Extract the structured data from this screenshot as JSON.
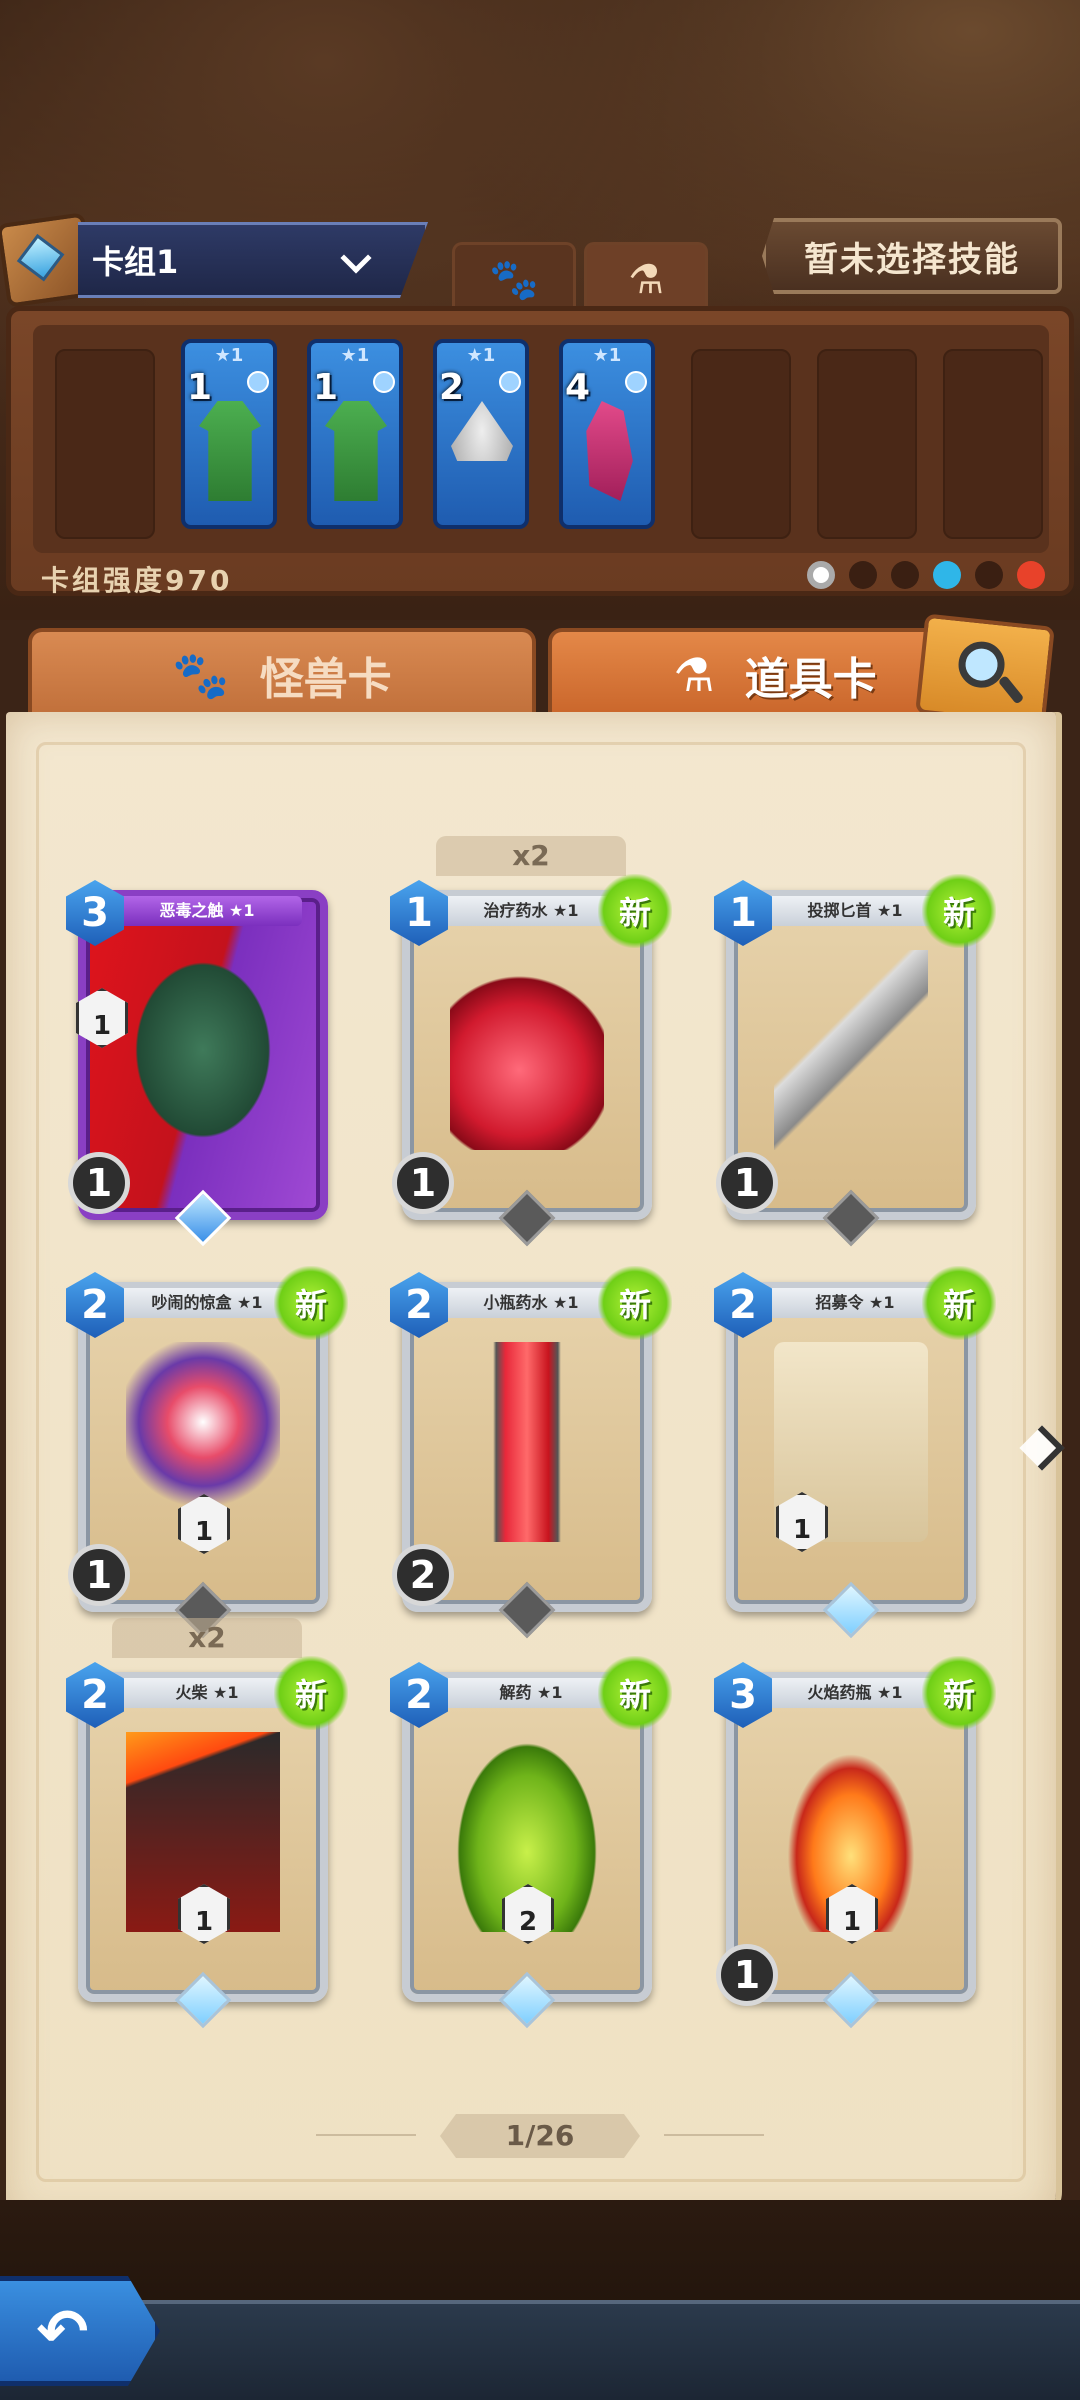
{
  "deck": {
    "name": "卡组1",
    "strength_label": "卡组强度970",
    "skill_button_label": "暂未选择技能",
    "cards": [
      {
        "stars": "★1",
        "cost": "1",
        "art": "robe"
      },
      {
        "stars": "★1",
        "cost": "1",
        "art": "robe"
      },
      {
        "stars": "★1",
        "cost": "2",
        "art": "helmet"
      },
      {
        "stars": "★1",
        "cost": "4",
        "art": "cloak"
      }
    ]
  },
  "tabs": {
    "monster_label": "怪兽卡",
    "item_label": "道具卡"
  },
  "collection": {
    "cards": [
      {
        "name": "恶毒之触 ★1",
        "cost": "3",
        "atk": "1",
        "stat": "1",
        "style": "purple",
        "dup": "",
        "new": ""
      },
      {
        "name": "治疗药水 ★1",
        "cost": "1",
        "atk": "1",
        "stat": "",
        "style": "normal",
        "dup": "x2",
        "new": "新"
      },
      {
        "name": "投掷匕首 ★1",
        "cost": "1",
        "atk": "1",
        "stat": "",
        "style": "normal",
        "dup": "",
        "new": "新"
      },
      {
        "name": "吵闹的惊盒 ★1",
        "cost": "2",
        "atk": "1",
        "stat": "1",
        "style": "normal",
        "dup": "",
        "new": "新"
      },
      {
        "name": "小瓶药水 ★1",
        "cost": "2",
        "atk": "2",
        "stat": "",
        "style": "normal",
        "dup": "",
        "new": "新"
      },
      {
        "name": "招募令 ★1",
        "cost": "2",
        "atk": "",
        "stat": "1",
        "style": "normal",
        "dup": "",
        "new": "新"
      },
      {
        "name": "火柴 ★1",
        "cost": "2",
        "atk": "",
        "stat": "1",
        "style": "normal",
        "dup": "x2",
        "new": "新"
      },
      {
        "name": "解药 ★1",
        "cost": "2",
        "atk": "",
        "stat": "2",
        "style": "normal",
        "dup": "",
        "new": "新"
      },
      {
        "name": "火焰药瓶 ★1",
        "cost": "3",
        "atk": "1",
        "stat": "1",
        "style": "normal",
        "dup": "",
        "new": "新"
      }
    ]
  },
  "pagination": {
    "label": "1/26"
  },
  "icons": {
    "back": "back-arrow-icon",
    "search": "magnifier-icon",
    "next": "chevron-right-icon"
  }
}
